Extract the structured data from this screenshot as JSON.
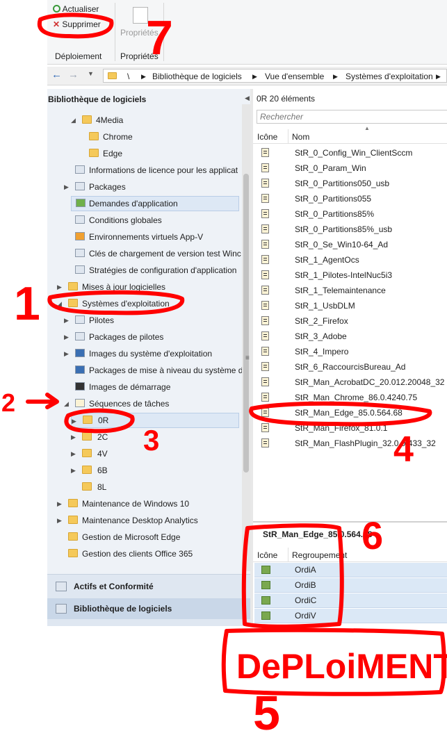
{
  "ribbon": {
    "refresh_label": "Actualiser",
    "delete_label": "Supprimer",
    "properties_label": "Propriétés",
    "group_deployment": "Déploiement",
    "group_properties": "Propriétés"
  },
  "addressbar": {
    "root_sep": "\\",
    "crumbs": [
      "Bibliothèque de logiciels",
      "Vue d'ensemble",
      "Systèmes d'exploitation"
    ]
  },
  "nav": {
    "title": "Bibliothèque de logiciels",
    "items": [
      "4Media",
      "Chrome",
      "Edge",
      "Informations de licence pour les applicat",
      "Packages",
      "Demandes d'application",
      "Conditions globales",
      "Environnements virtuels App-V",
      "Clés de chargement de version test Winc",
      "Stratégies de configuration d'application",
      "Mises à jour logicielles",
      "Systèmes d'exploitation",
      "Pilotes",
      "Packages de pilotes",
      "Images du système d'exploitation",
      "Packages de mise à niveau du système d",
      "Images de démarrage",
      "Séquences de tâches",
      "0R",
      "2C",
      "4V",
      "6B",
      "8L",
      "Maintenance de Windows 10",
      "Maintenance Desktop Analytics",
      "Gestion de Microsoft Edge",
      "Gestion des clients Office 365"
    ],
    "workspaces": [
      "Actifs et Conformité",
      "Bibliothèque de logiciels"
    ]
  },
  "list": {
    "header": "0R 20 éléments",
    "search_placeholder": "Rechercher",
    "col_icon": "Icône",
    "col_name": "Nom",
    "rows": [
      "StR_0_Config_Win_ClientSccm",
      "StR_0_Param_Win",
      "StR_0_Partitions050_usb",
      "StR_0_Partitions055",
      "StR_0_Partitions85%",
      "StR_0_Partitions85%_usb",
      "StR_0_Se_Win10-64_Ad",
      "StR_1_AgentOcs",
      "StR_1_Pilotes-IntelNuc5i3",
      "StR_1_Telemaintenance",
      "StR_1_UsbDLM",
      "StR_2_Firefox",
      "StR_3_Adobe",
      "StR_4_Impero",
      "StR_6_RaccourcisBureau_Ad",
      "StR_Man_AcrobatDC_20.012.20048_32",
      "StR_Man_Chrome_86.0.4240.75",
      "StR_Man_Edge_85.0.564.68",
      "StR_Man_Firefox_81.0.1",
      "StR_Man_FlashPlugin_32.0.0.433_32"
    ]
  },
  "detail": {
    "title": "StR_Man_Edge_85.0.564.68",
    "col_icon": "Icône",
    "col_group": "Regroupement",
    "rows": [
      "OrdiA",
      "OrdiB",
      "OrdiC",
      "OrdiV"
    ]
  },
  "annotations": {
    "n1": "1",
    "n2": "2",
    "n3": "3",
    "n4": "4",
    "n5": "5",
    "n6": "6",
    "n7": "7",
    "deploiement": "DePLoiMENT"
  },
  "colors": {
    "annotation": "#ff0000",
    "nav_bg": "#eef2f7",
    "selection": "#dde8f5"
  }
}
